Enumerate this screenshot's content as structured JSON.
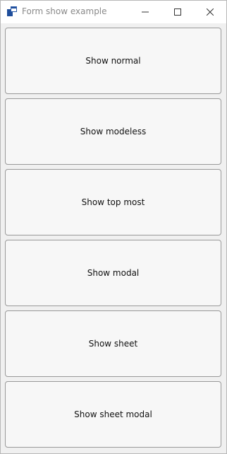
{
  "window": {
    "title": "Form show example",
    "icon": "winforms-app-icon",
    "accent": "#1f4e9b"
  },
  "caption_buttons": {
    "minimize_icon": "minimize-icon",
    "maximize_icon": "maximize-icon",
    "close_icon": "close-icon"
  },
  "buttons": [
    {
      "label": "Show normal"
    },
    {
      "label": "Show modeless"
    },
    {
      "label": "Show top most"
    },
    {
      "label": "Show modal"
    },
    {
      "label": "Show sheet"
    },
    {
      "label": "Show sheet modal"
    }
  ]
}
